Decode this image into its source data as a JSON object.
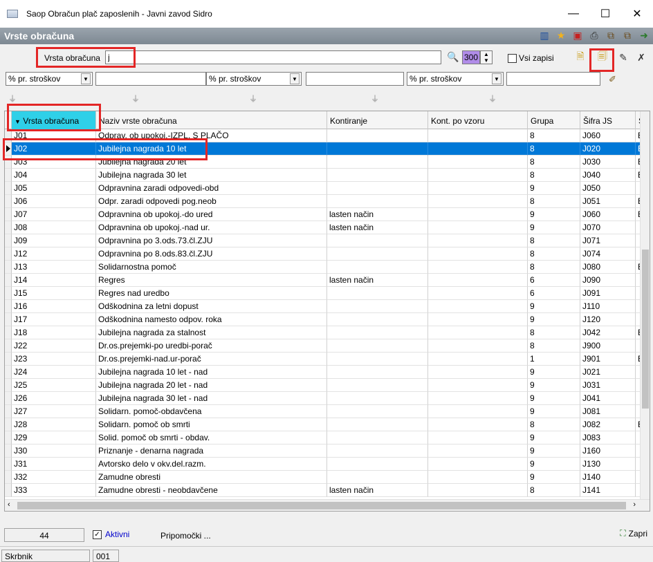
{
  "window": {
    "title": "Saop Obračun plač zaposlenih - Javni zavod Sidro",
    "minimize_glyph": "—",
    "maximize_glyph": "☐",
    "close_glyph": "✕"
  },
  "panel": {
    "title": "Vrste obračuna"
  },
  "toolbar": {
    "icons": [
      "columns-icon",
      "star-icon",
      "pdf-icon",
      "print-icon",
      "copy-icon",
      "paste-icon",
      "exit-icon"
    ]
  },
  "search": {
    "label": "Vrsta obračuna",
    "value": "j",
    "count": "300",
    "vsi_zapisi_label": "Vsi zapisi",
    "vsi_zapisi_checked": false
  },
  "filters": [
    {
      "select": "% pr. stroškov"
    },
    {
      "select": "% pr. stroškov"
    },
    {
      "select": "% pr. stroškov"
    }
  ],
  "table": {
    "columns": [
      "Vrsta obračuna",
      "Naziv vrste obračuna",
      "Kontiranje",
      "Kont. po vzoru",
      "Grupa",
      "Šifra JS",
      "Š"
    ],
    "sorted_column": 0,
    "selected_row": 1,
    "rows": [
      [
        "J01",
        "Odprav. ob upokoj.-IZPL. S PLAČO",
        "",
        "",
        "8",
        "J060",
        "B"
      ],
      [
        "J02",
        "Jubilejna nagrada 10 let",
        "",
        "",
        "8",
        "J020",
        "B"
      ],
      [
        "J03",
        "Jubilejna nagrada 20 let",
        "",
        "",
        "8",
        "J030",
        "B"
      ],
      [
        "J04",
        "Jubilejna nagrada 30 let",
        "",
        "",
        "8",
        "J040",
        "B"
      ],
      [
        "J05",
        "Odpravnina zaradi odpovedi-obd",
        "",
        "",
        "9",
        "J050",
        ""
      ],
      [
        "J06",
        "Odpr. zaradi odpovedi pog.neob",
        "",
        "",
        "8",
        "J051",
        "B"
      ],
      [
        "J07",
        "Odpravnina ob upokoj.-do ured",
        "lasten način",
        "",
        "9",
        "J060",
        "B"
      ],
      [
        "J08",
        "Odpravnina ob upokoj.-nad ur.",
        "lasten način",
        "",
        "9",
        "J070",
        ""
      ],
      [
        "J09",
        "Odpravnina po 3.ods.73.čl.ZJU",
        "",
        "",
        "8",
        "J071",
        ""
      ],
      [
        "J12",
        "Odpravnina po 8.ods.83.čl.ZJU",
        "",
        "",
        "8",
        "J074",
        ""
      ],
      [
        "J13",
        "Solidarnostna pomoč",
        "",
        "",
        "8",
        "J080",
        "B"
      ],
      [
        "J14",
        "Regres",
        "lasten način",
        "",
        "6",
        "J090",
        ""
      ],
      [
        "J15",
        "Regres nad uredbo",
        "",
        "",
        "6",
        "J091",
        ""
      ],
      [
        "J16",
        "Odškodnina za letni dopust",
        "",
        "",
        "9",
        "J110",
        ""
      ],
      [
        "J17",
        "Odškodnina namesto odpov. roka",
        "",
        "",
        "9",
        "J120",
        ""
      ],
      [
        "J18",
        "Jubilejna nagrada za stalnost",
        "",
        "",
        "8",
        "J042",
        "B"
      ],
      [
        "J22",
        "Dr.os.prejemki-po uredbi-porač",
        "",
        "",
        "8",
        "J900",
        ""
      ],
      [
        "J23",
        "Dr.os.prejemki-nad.ur-porač",
        "",
        "",
        "1",
        "J901",
        "B"
      ],
      [
        "J24",
        "Jubilejna nagrada 10 let - nad",
        "",
        "",
        "9",
        "J021",
        ""
      ],
      [
        "J25",
        "Jubilejna nagrada 20 let - nad",
        "",
        "",
        "9",
        "J031",
        ""
      ],
      [
        "J26",
        "Jubilejna nagrada 30 let - nad",
        "",
        "",
        "9",
        "J041",
        ""
      ],
      [
        "J27",
        "Solidarn. pomoč-obdavčena",
        "",
        "",
        "9",
        "J081",
        ""
      ],
      [
        "J28",
        "Solidarn. pomoč ob smrti",
        "",
        "",
        "8",
        "J082",
        "B"
      ],
      [
        "J29",
        "Solid. pomoč ob smrti - obdav.",
        "",
        "",
        "9",
        "J083",
        ""
      ],
      [
        "J30",
        "Priznanje - denarna nagrada",
        "",
        "",
        "9",
        "J160",
        ""
      ],
      [
        "J31",
        "Avtorsko delo  v okv.del.razm.",
        "",
        "",
        "9",
        "J130",
        ""
      ],
      [
        "J32",
        "Zamudne obresti",
        "",
        "",
        "9",
        "J140",
        ""
      ],
      [
        "J33",
        "Zamudne obresti - neobdavčene",
        "lasten način",
        "",
        "8",
        "J141",
        ""
      ]
    ]
  },
  "footer": {
    "count": "44",
    "aktivni_label": "Aktivni",
    "aktivni_checked": true,
    "pripomocki_label": "Pripomočki ...",
    "zapri_label": "Zapri"
  },
  "statusbar": {
    "user": "Skrbnik",
    "code": "001"
  },
  "colors": {
    "selected_row": "#0078d7",
    "sorted_header": "#2fd0e8",
    "highlight_box": "#e32626",
    "count_box": "#b08ce8"
  }
}
